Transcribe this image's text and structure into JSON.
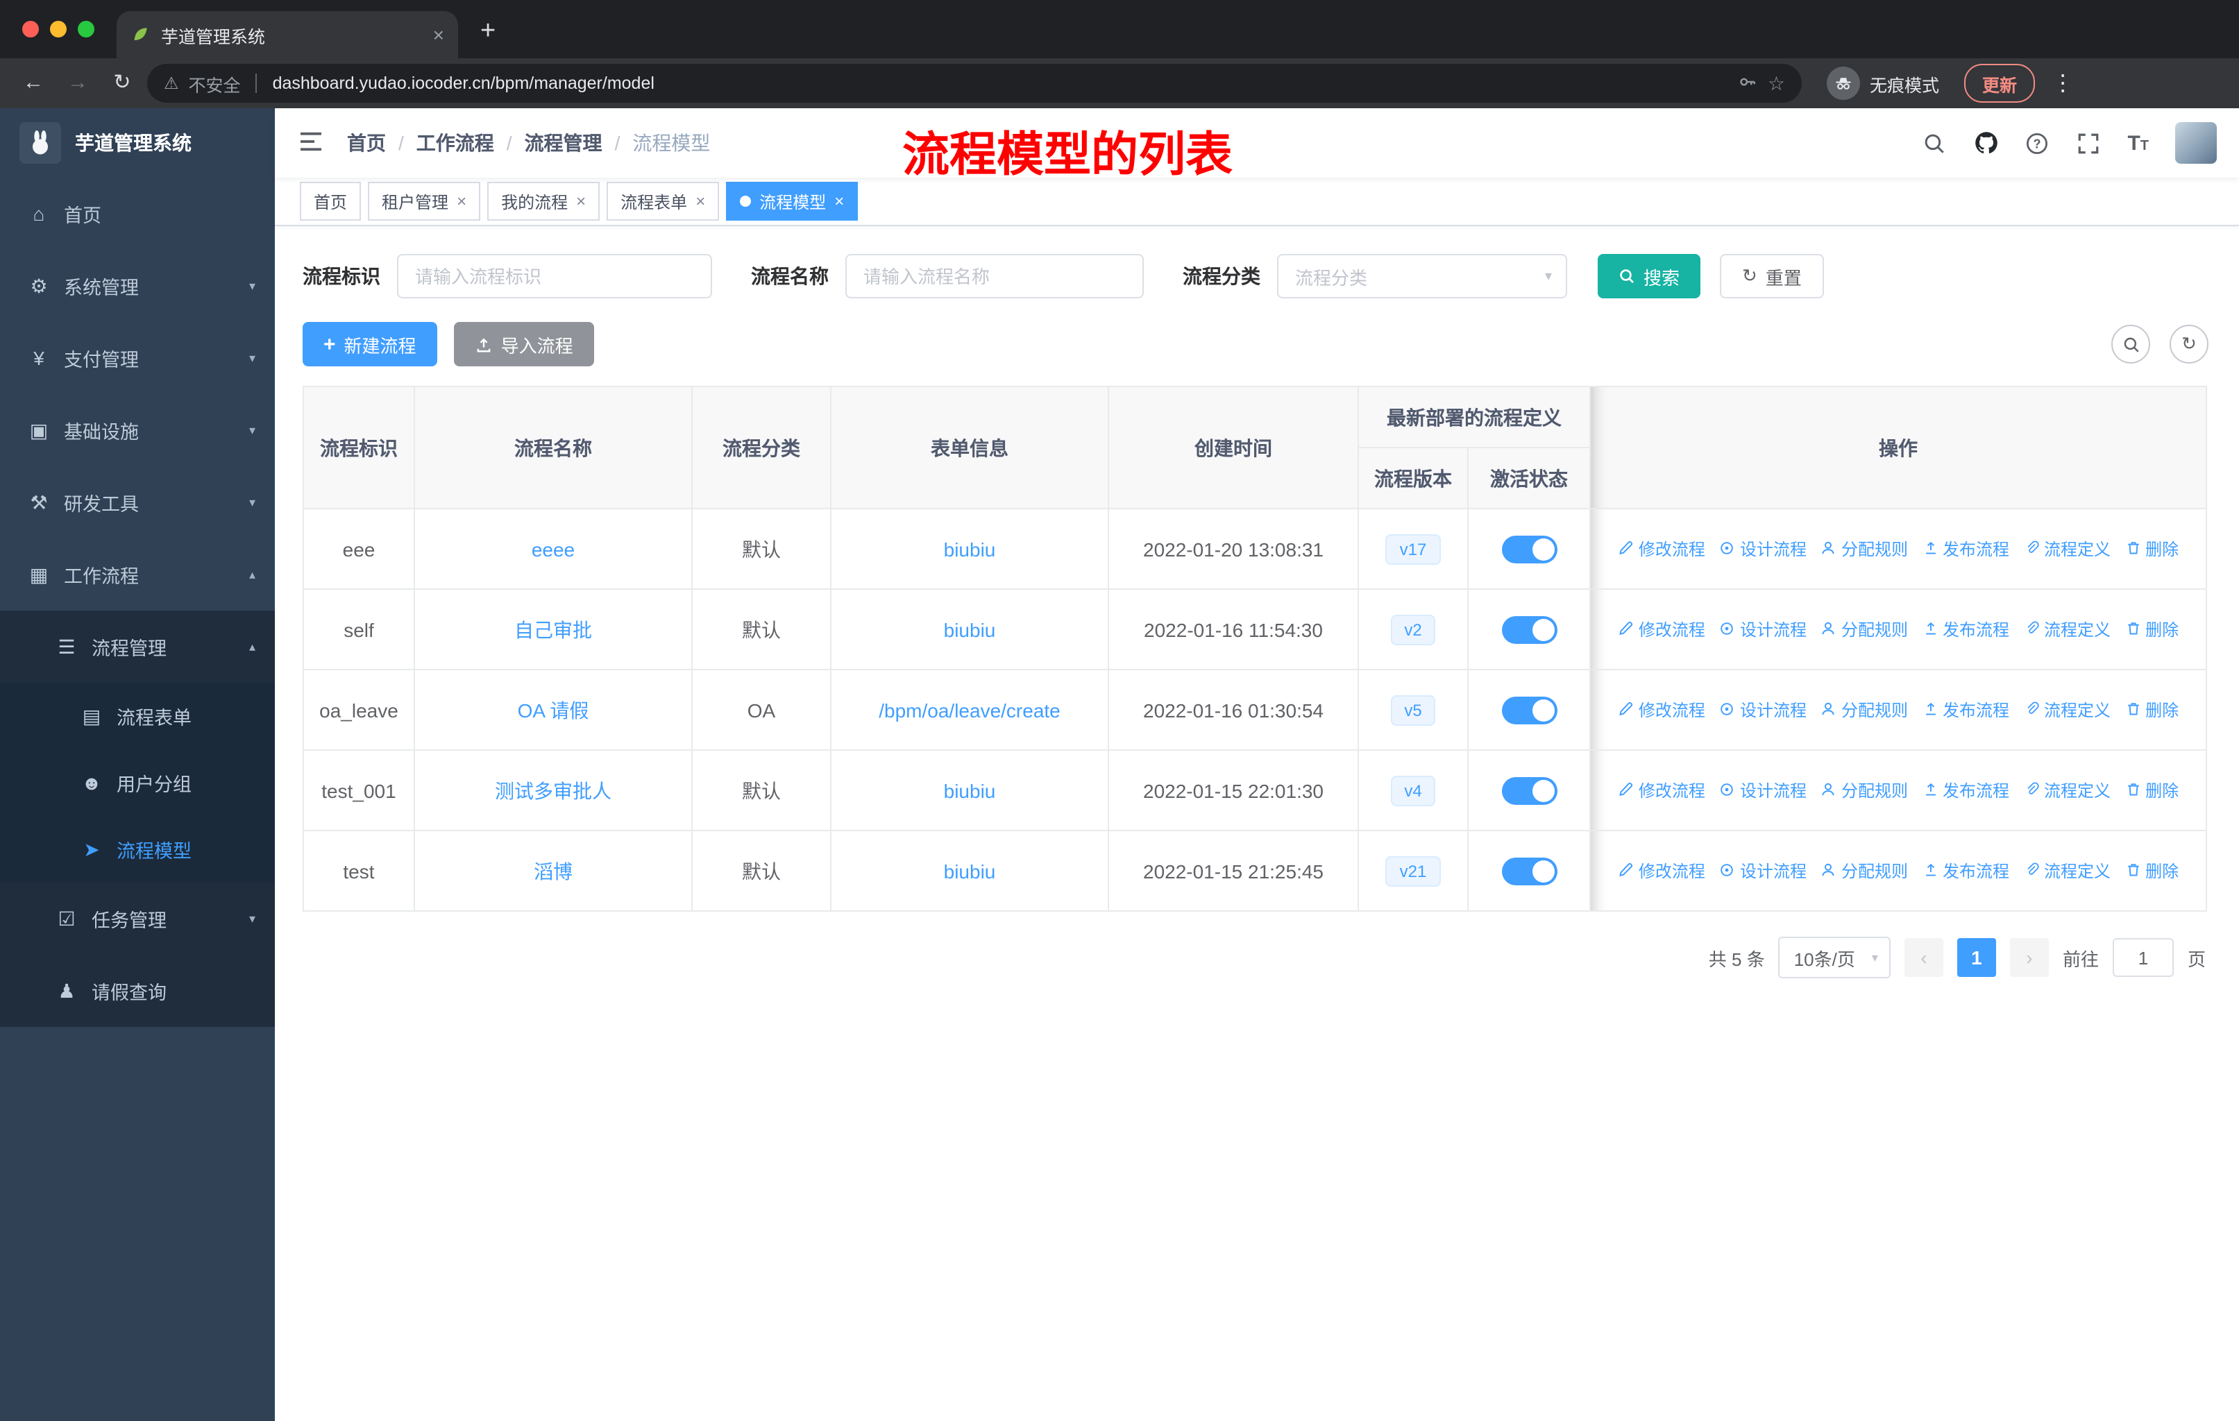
{
  "colors": {
    "primary": "#409eff",
    "search_button": "#17b3a3",
    "sidebar_bg": "#304156",
    "annotation_red": "#ff0000",
    "update_chip": "#f28b82",
    "tag_bg": "#ecf5ff"
  },
  "browser": {
    "tab_title": "芋道管理系统",
    "security_label": "不安全",
    "url": "dashboard.yudao.iocoder.cn/bpm/manager/model",
    "incognito_label": "无痕模式",
    "update_label": "更新"
  },
  "sidebar": {
    "logo_title": "芋道管理系统",
    "items": [
      {
        "label": "首页",
        "icon": "home-icon"
      },
      {
        "label": "系统管理",
        "icon": "gear-icon"
      },
      {
        "label": "支付管理",
        "icon": "payment-icon"
      },
      {
        "label": "基础设施",
        "icon": "infrastructure-icon"
      },
      {
        "label": "研发工具",
        "icon": "devtools-icon"
      },
      {
        "label": "工作流程",
        "icon": "workflow-icon"
      },
      {
        "label": "流程管理",
        "icon": "process-management-icon"
      },
      {
        "label": "流程表单",
        "icon": "form-icon"
      },
      {
        "label": "用户分组",
        "icon": "user-group-icon"
      },
      {
        "label": "流程模型",
        "icon": "send-icon"
      },
      {
        "label": "任务管理",
        "icon": "task-icon"
      },
      {
        "label": "请假查询",
        "icon": "person-icon"
      }
    ]
  },
  "navbar": {
    "breadcrumb": [
      "首页",
      "工作流程",
      "流程管理",
      "流程模型"
    ],
    "annotation": "流程模型的列表"
  },
  "tags": [
    {
      "label": "首页"
    },
    {
      "label": "租户管理"
    },
    {
      "label": "我的流程"
    },
    {
      "label": "流程表单"
    },
    {
      "label": "流程模型"
    }
  ],
  "filters": {
    "id_label": "流程标识",
    "id_placeholder": "请输入流程标识",
    "name_label": "流程名称",
    "name_placeholder": "请输入流程名称",
    "category_label": "流程分类",
    "category_placeholder": "流程分类",
    "search_label": "搜索",
    "reset_label": "重置"
  },
  "toolbar": {
    "create_label": "新建流程",
    "import_label": "导入流程"
  },
  "table": {
    "col_id": "流程标识",
    "col_name": "流程名称",
    "col_category": "流程分类",
    "col_form": "表单信息",
    "col_created": "创建时间",
    "group_deploy": "最新部署的流程定义",
    "col_version": "流程版本",
    "col_active": "激活状态",
    "col_ops": "操作",
    "rows": [
      {
        "id": "eee",
        "name": "eeee",
        "category": "默认",
        "form": "biubiu",
        "created": "2022-01-20 13:08:31",
        "version": "v17",
        "active": true
      },
      {
        "id": "self",
        "name": "自己审批",
        "category": "默认",
        "form": "biubiu",
        "created": "2022-01-16 11:54:30",
        "version": "v2",
        "active": true
      },
      {
        "id": "oa_leave",
        "name": "OA 请假",
        "category": "OA",
        "form": "/bpm/oa/leave/create",
        "created": "2022-01-16 01:30:54",
        "version": "v5",
        "active": true
      },
      {
        "id": "test_001",
        "name": "测试多审批人",
        "category": "默认",
        "form": "biubiu",
        "created": "2022-01-15 22:01:30",
        "version": "v4",
        "active": true
      },
      {
        "id": "test",
        "name": "滔博",
        "category": "默认",
        "form": "biubiu",
        "created": "2022-01-15 21:25:45",
        "version": "v21",
        "active": true
      }
    ],
    "actions": [
      {
        "name": "modify-process-link",
        "icon": "edit-icon",
        "label": "修改流程"
      },
      {
        "name": "design-process-link",
        "icon": "design-icon",
        "label": "设计流程"
      },
      {
        "name": "assign-rule-link",
        "icon": "user-icon",
        "label": "分配规则"
      },
      {
        "name": "publish-process-link",
        "icon": "publish-icon",
        "label": "发布流程"
      },
      {
        "name": "process-definition-link",
        "icon": "link-icon",
        "label": "流程定义"
      },
      {
        "name": "delete-link",
        "icon": "delete-icon",
        "label": "删除"
      }
    ]
  },
  "pagination": {
    "total": "共 5 条",
    "page_size": "10条/页",
    "page": "1",
    "goto_label": "前往",
    "goto_value": "1",
    "page_unit": "页"
  }
}
